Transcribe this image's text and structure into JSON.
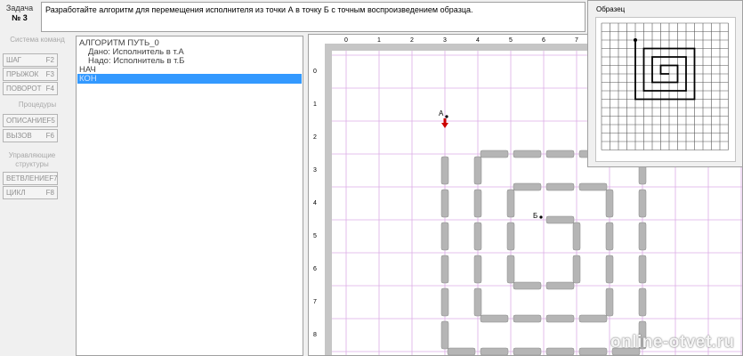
{
  "task": {
    "label": "Задача",
    "number": "№ 3",
    "text": "Разработайте алгоритм для перемещения исполнителя из точки А в точку Б с точным воспроизведением образца."
  },
  "commands": {
    "group1_title": "Система команд",
    "group2_title": "Процедуры",
    "group3_title": "Управляющие структуры",
    "step": {
      "label": "ШАГ",
      "key": "F2"
    },
    "jump": {
      "label": "ПРЫЖОК",
      "key": "F3"
    },
    "turn": {
      "label": "ПОВОРОТ",
      "key": "F4"
    },
    "describe": {
      "label": "ОПИСАНИЕ",
      "key": "F5"
    },
    "call": {
      "label": "ВЫЗОВ",
      "key": "F6"
    },
    "branch": {
      "label": "ВЕТВЛЕНИЕ",
      "key": "F7"
    },
    "loop": {
      "label": "ЦИКЛ",
      "key": "F8"
    }
  },
  "program": {
    "header": "АЛГОРИТМ ПУТЬ_0",
    "given": "Дано: Исполнитель в т.А",
    "required": "Надо: Исполнитель в т.Б",
    "begin": "НАЧ",
    "selected": "КОН"
  },
  "field": {
    "col_labels": [
      "0",
      "1",
      "2",
      "3",
      "4",
      "5",
      "6",
      "7"
    ],
    "row_labels": [
      "0",
      "1",
      "2",
      "3",
      "4",
      "5",
      "6",
      "7",
      "8"
    ],
    "point_a": "А",
    "point_b": "Б",
    "colors": {
      "grid": "#dcaee6",
      "wall": "#b5b5b5",
      "wall_dark": "#888888",
      "arrow": "#cc0000"
    }
  },
  "sample": {
    "title": "Образец"
  },
  "watermark": "online-otvet.ru"
}
